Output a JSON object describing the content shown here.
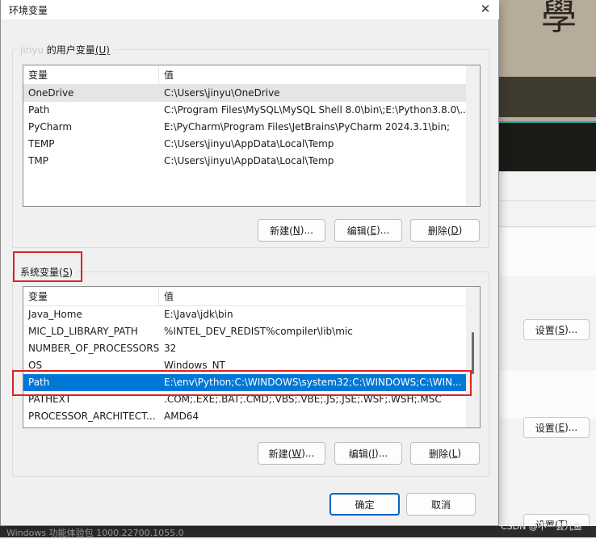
{
  "dialog": {
    "title": "环境变量",
    "close_glyph": "✕"
  },
  "user_section": {
    "legend_user": "jinyu",
    "legend_text": " 的用户变量",
    "legend_access": "(U)",
    "columns": {
      "name": "变量",
      "value": "值"
    },
    "rows": [
      {
        "name": "OneDrive",
        "value": "C:\\Users\\jinyu\\OneDrive"
      },
      {
        "name": "Path",
        "value": "C:\\Program Files\\MySQL\\MySQL Shell 8.0\\bin\\;E:\\Python3.8.0\\..."
      },
      {
        "name": "PyCharm",
        "value": "E:\\PyCharm\\Program Files\\JetBrains\\PyCharm 2024.3.1\\bin;"
      },
      {
        "name": "TEMP",
        "value": "C:\\Users\\jinyu\\AppData\\Local\\Temp"
      },
      {
        "name": "TMP",
        "value": "C:\\Users\\jinyu\\AppData\\Local\\Temp"
      }
    ],
    "buttons": {
      "new": {
        "label": "新建(",
        "key": "N",
        "suffix": ")..."
      },
      "edit": {
        "label": "编辑(",
        "key": "E",
        "suffix": ")..."
      },
      "delete": {
        "label": "删除(",
        "key": "D",
        "suffix": ")"
      }
    }
  },
  "system_section": {
    "legend_text": "系统变量(",
    "legend_key": "S",
    "legend_suffix": ")",
    "columns": {
      "name": "变量",
      "value": "值"
    },
    "rows": [
      {
        "name": "Java_Home",
        "value": "E:\\Java\\jdk\\bin"
      },
      {
        "name": "MIC_LD_LIBRARY_PATH",
        "value": "%INTEL_DEV_REDIST%compiler\\lib\\mic"
      },
      {
        "name": "NUMBER_OF_PROCESSORS",
        "value": "32"
      },
      {
        "name": "OS",
        "value": "Windows_NT"
      },
      {
        "name": "Path",
        "value": "E:\\env\\Python;C:\\WINDOWS\\system32;C:\\WINDOWS;C:\\WIN..."
      },
      {
        "name": "PATHEXT",
        "value": ".COM;.EXE;.BAT;.CMD;.VBS;.VBE;.JS;.JSE;.WSF;.WSH;.MSC"
      },
      {
        "name": "PROCESSOR_ARCHITECT...",
        "value": "AMD64"
      }
    ],
    "selected_index": 4,
    "buttons": {
      "new": {
        "label": "新建(",
        "key": "W",
        "suffix": ")..."
      },
      "edit": {
        "label": "编辑(",
        "key": "I",
        "suffix": ")..."
      },
      "delete": {
        "label": "删除(",
        "key": "L",
        "suffix": ")"
      }
    }
  },
  "footer": {
    "ok": "确定",
    "cancel": "取消"
  },
  "background": {
    "glyph": "學",
    "settings_buttons": [
      {
        "label": "设置(",
        "key": "S",
        "suffix": ")..."
      },
      {
        "label": "设置(",
        "key": "E",
        "suffix": ")..."
      },
      {
        "label": "设置(",
        "key": "T",
        "suffix": ")..."
      }
    ],
    "taskbar_text": "Windows 功能体验包 1000.22700.1055.0",
    "watermark": "CSDN @不一会儿鱼"
  },
  "colors": {
    "selection": "#0078d7",
    "annotation": "#e02020",
    "primary_border": "#0067c0"
  }
}
